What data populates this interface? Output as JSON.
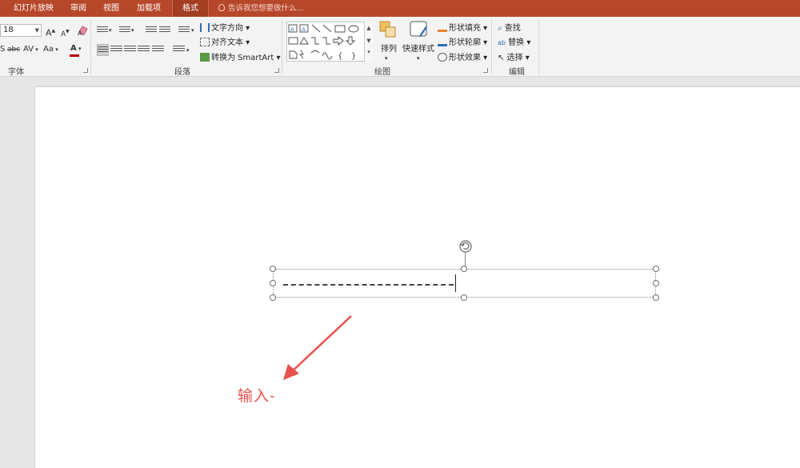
{
  "tabs": {
    "slideshow": "幻灯片放映",
    "review": "审阅",
    "view": "视图",
    "addins": "加载项",
    "format": "格式",
    "tell_me": "告诉我您想要做什么..."
  },
  "ribbon": {
    "font": {
      "size": "18",
      "group_label": "字体",
      "grow_font": "A",
      "shrink_font": "A",
      "strikethrough": "abc",
      "char_spacing": "AV",
      "change_case": "Aa",
      "font_color": "A"
    },
    "paragraph": {
      "text_direction": "文字方向",
      "align_text": "对齐文本",
      "convert_smartart": "转换为 SmartArt",
      "group_label": "段落"
    },
    "drawing": {
      "arrange": "排列",
      "quick_styles": "快速样式",
      "shape_fill": "形状填充",
      "shape_outline": "形状轮廓",
      "shape_effects": "形状效果",
      "group_label": "绘图"
    },
    "editing": {
      "find": "查找",
      "replace": "替换",
      "select": "选择",
      "group_label": "编辑"
    }
  },
  "colors": {
    "accent": "#b7472a",
    "annotation": "#e8504e",
    "font_color_bar": "#c00000"
  },
  "slide": {
    "annotation_text": "输入-"
  }
}
